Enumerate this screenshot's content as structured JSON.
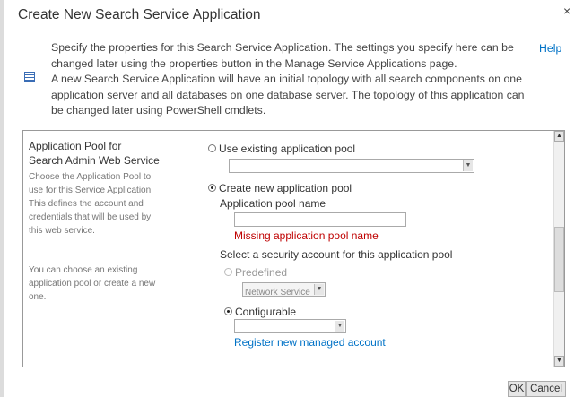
{
  "dialog": {
    "title": "Create New Search Service Application",
    "close": "×",
    "help": "Help",
    "intro_1": "Specify the properties for this Search Service Application. The settings you specify here can be changed later using the properties button in the Manage Service Applications page.",
    "intro_2": "A new Search Service Application will have an initial topology with all search components on one application server and all databases on one database server. The topology of this application can be changed later using PowerShell cmdlets."
  },
  "section": {
    "title_1": "Application Pool for",
    "title_2": "Search Admin Web Service",
    "desc_1": "Choose the Application Pool to use for this Service Application.  This defines the account and credentials that will be used by this web service.",
    "desc_2": "You can choose an existing application pool or create a new one."
  },
  "form": {
    "use_existing": "Use existing application pool",
    "existing_value": "",
    "create_new": "Create new application pool",
    "pool_name_label": "Application pool name",
    "pool_name_value": "",
    "error": "Missing application pool name",
    "security_label": "Select a security account for this application pool",
    "predefined": "Predefined",
    "predefined_value": "Network Service",
    "configurable": "Configurable",
    "configurable_value": "",
    "register_link": "Register new managed account"
  },
  "buttons": {
    "ok": "OK",
    "cancel": "Cancel"
  }
}
